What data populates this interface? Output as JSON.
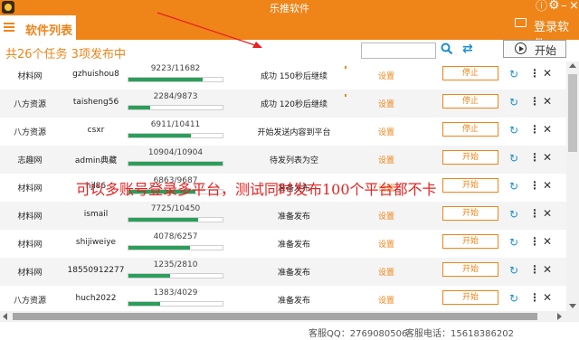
{
  "window": {
    "title": "乐推软件"
  },
  "tab": {
    "label": "软件列表"
  },
  "header": {
    "login_label": "登录软件",
    "icons": [
      "alert-icon",
      "settings-icon",
      "minimize-icon",
      "close-icon"
    ]
  },
  "toolbar": {
    "summary": "共26个任务 3项发布中",
    "search_value": "",
    "start_all_label": "开始"
  },
  "tasks": [
    {
      "site": "材料网",
      "account": "gzhuishou8",
      "count": "9223/11682",
      "progress": 0.79,
      "status": "成功 150秒后继续",
      "settings": "设置",
      "action": "停止"
    },
    {
      "site": "八方资源",
      "account": "taisheng56",
      "count": "2284/9873",
      "progress": 0.23,
      "status": "成功 120秒后继续",
      "settings": "设置",
      "action": "停止"
    },
    {
      "site": "八方资源",
      "account": "csxr",
      "count": "6911/10411",
      "progress": 0.66,
      "status": "开始发送内容到平台",
      "settings": "设置",
      "action": "停止"
    },
    {
      "site": "志趣网",
      "account": "admin典藏",
      "count": "10904/10904",
      "progress": 1.0,
      "status": "待发列表为空",
      "settings": "设置",
      "action": "开始"
    },
    {
      "site": "材料网",
      "account": "hjl86",
      "count": "6863/9687",
      "progress": 0.71,
      "status": "准备发布",
      "settings": "设置",
      "action": "开始"
    },
    {
      "site": "材料网",
      "account": "ismail",
      "count": "7725/10450",
      "progress": 0.74,
      "status": "准备发布",
      "settings": "设置",
      "action": "开始"
    },
    {
      "site": "材料网",
      "account": "shijiweiye",
      "count": "4078/6257",
      "progress": 0.65,
      "status": "准备发布",
      "settings": "设置",
      "action": "开始"
    },
    {
      "site": "材料网",
      "account": "18550912277",
      "count": "1235/2810",
      "progress": 0.44,
      "status": "准备发布",
      "settings": "设置",
      "action": "开始"
    },
    {
      "site": "八方资源",
      "account": "huch2022",
      "count": "1383/4029",
      "progress": 0.34,
      "status": "准备发布",
      "settings": "设置",
      "action": "开始"
    }
  ],
  "overlay": {
    "caption": "可以多账号登录多平台，测试同时发布100个平台都不卡"
  },
  "footer": {
    "qq": "客服QQ：2769080506",
    "phone": "客服电话：15618386202"
  },
  "colors": {
    "accent": "#ef8418",
    "progress": "#2b9e5b",
    "annotation": "#e62121"
  }
}
